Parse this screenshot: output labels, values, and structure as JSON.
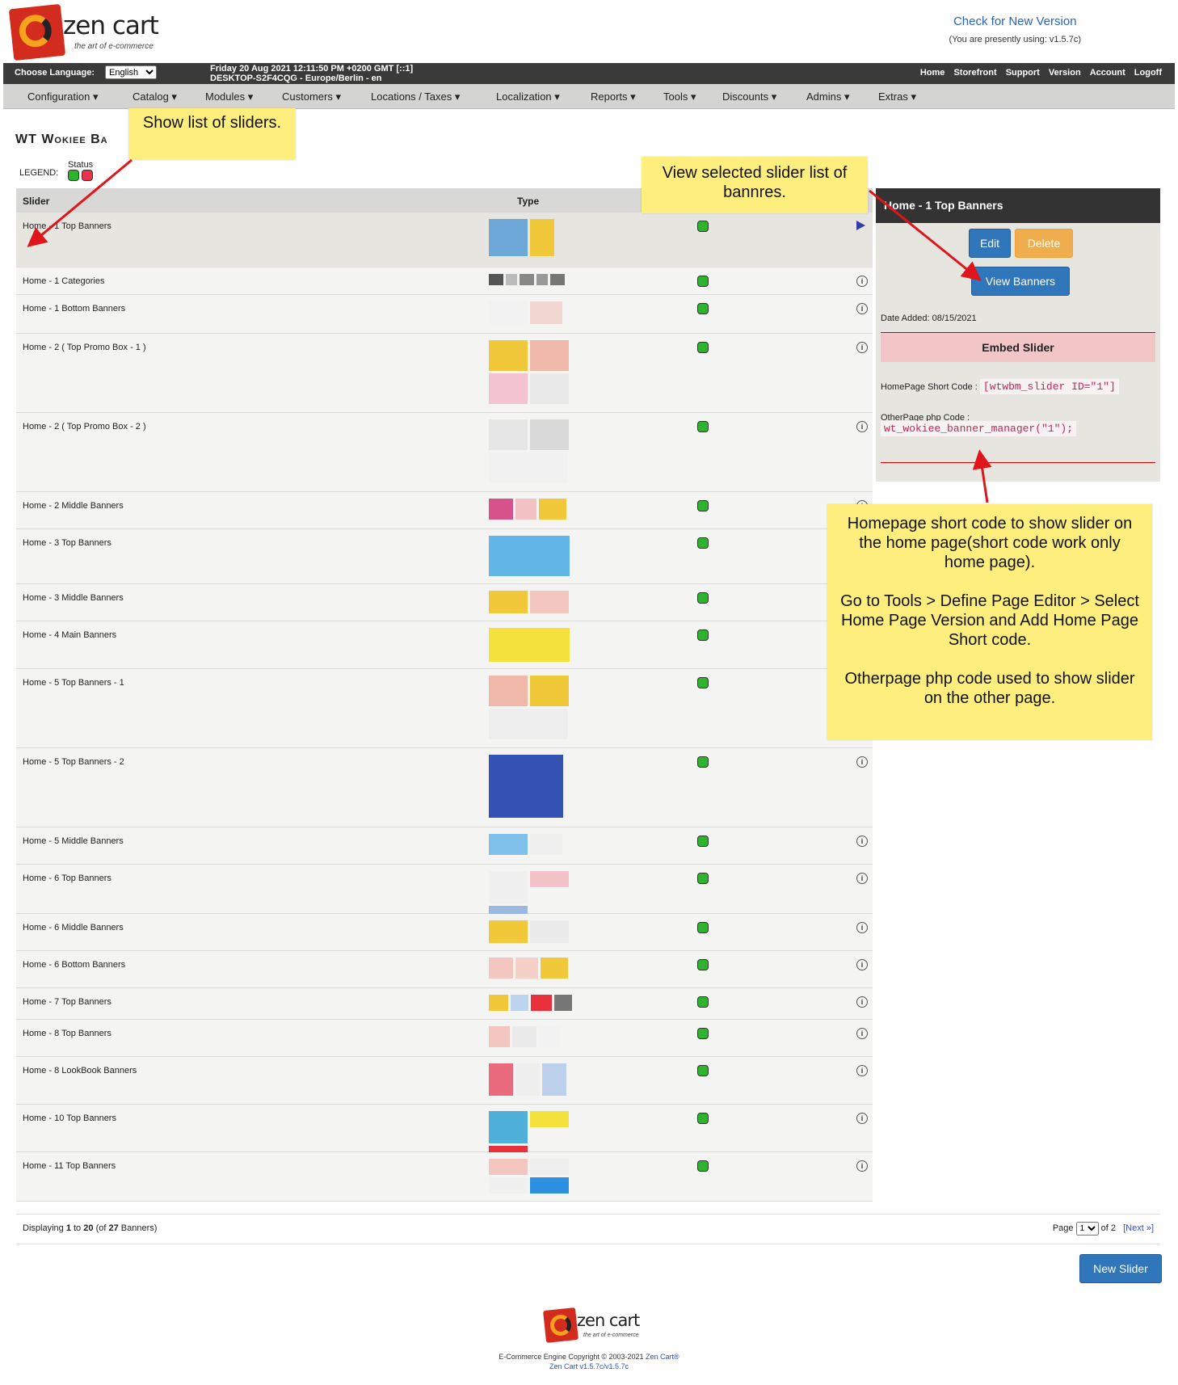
{
  "header": {
    "logo_text": "zen cart",
    "logo_tagline": "the art of e-commerce",
    "check_version": "Check for New Version",
    "presently_using": "(You are presently using: v1.5.7c)"
  },
  "topbar": {
    "choose_language": "Choose Language:",
    "language": "English",
    "datetime": "Friday 20 Aug 2021 12:11:50 PM +0200 GMT [::1]",
    "host": "DESKTOP-S2F4CQG - Europe/Berlin - en",
    "links": [
      "Home",
      "Storefront",
      "Support",
      "Version",
      "Account",
      "Logoff"
    ]
  },
  "menu": [
    "Configuration",
    "Catalog",
    "Modules",
    "Customers",
    "Locations / Taxes",
    "Localization",
    "Reports",
    "Tools",
    "Discounts",
    "Admins",
    "Extras"
  ],
  "page_title": "WT Wokiee Ba",
  "legend": {
    "label": "LEGEND:",
    "status": "Status"
  },
  "table": {
    "col_slider": "Slider",
    "col_type": "Type",
    "rows": [
      {
        "name": "Home - 1 Top Banners",
        "status": "active",
        "selected": true
      },
      {
        "name": "Home - 1 Categories",
        "status": "active"
      },
      {
        "name": "Home - 1 Bottom Banners",
        "status": "active"
      },
      {
        "name": "Home - 2 ( Top Promo Box - 1 )",
        "status": "active"
      },
      {
        "name": "Home - 2 ( Top Promo Box - 2 )",
        "status": "active"
      },
      {
        "name": "Home - 2 Middle Banners",
        "status": "active"
      },
      {
        "name": "Home - 3 Top Banners",
        "status": "active"
      },
      {
        "name": "Home - 3 Middle Banners",
        "status": "active"
      },
      {
        "name": "Home - 4 Main Banners",
        "status": "active"
      },
      {
        "name": "Home - 5 Top Banners - 1",
        "status": "active"
      },
      {
        "name": "Home - 5 Top Banners - 2",
        "status": "active"
      },
      {
        "name": "Home - 5 Middle Banners",
        "status": "active"
      },
      {
        "name": "Home - 6 Top Banners",
        "status": "active"
      },
      {
        "name": "Home - 6 Middle Banners",
        "status": "active"
      },
      {
        "name": "Home - 6 Bottom Banners",
        "status": "active"
      },
      {
        "name": "Home - 7 Top Banners",
        "status": "active"
      },
      {
        "name": "Home - 8 Top Banners",
        "status": "active"
      },
      {
        "name": "Home - 8 LookBook Banners",
        "status": "active"
      },
      {
        "name": "Home - 10 Top Banners",
        "status": "active"
      },
      {
        "name": "Home - 11 Top Banners",
        "status": "active"
      }
    ]
  },
  "side": {
    "title": "Home - 1 Top Banners",
    "edit": "Edit",
    "delete": "Delete",
    "view_banners": "View Banners",
    "date_added": "Date Added: 08/15/2021",
    "embed_title": "Embed Slider",
    "homepage_label": "HomePage Short Code :",
    "homepage_code": "[wtwbm_slider ID=\"1\"]",
    "otherpage_label": "OtherPage php Code :",
    "otherpage_code": "wt_wokiee_banner_manager(\"1\");"
  },
  "pagination": {
    "displaying_prefix": "Displaying",
    "from": "1",
    "to_word": "to",
    "to": "20",
    "of_prefix": "(of",
    "total": "27",
    "suffix": "Banners)",
    "page_label": "Page",
    "page": "1",
    "of_pages": "of 2",
    "next": "[Next »]"
  },
  "new_slider": "New Slider",
  "footer": {
    "logo_text": "zen cart",
    "logo_tagline": "the art of e-commerce",
    "copyright": "E-Commerce Engine Copyright © 2003-2021",
    "zen_link": "Zen Cart®",
    "version": "Zen Cart v1.5.7c/v1.5.7c"
  },
  "notes": {
    "show_list": "Show list of sliders.",
    "view_selected": "View selected slider list of bannres.",
    "shortcode_1": "Homepage short code to show slider on the home page(short code work only home page).",
    "shortcode_2": "Go to Tools > Define Page Editor > Select Home Page Version and Add Home Page Short code.",
    "shortcode_3": "Otherpage php code used to show slider on the other page."
  },
  "colors": {
    "note_bg": "#fdee7e",
    "active_status": "#2db42d",
    "inactive_status": "#e8334b",
    "button_blue": "#2f76ba",
    "button_orange": "#f0ad4e",
    "arrow": "#e0141b"
  }
}
